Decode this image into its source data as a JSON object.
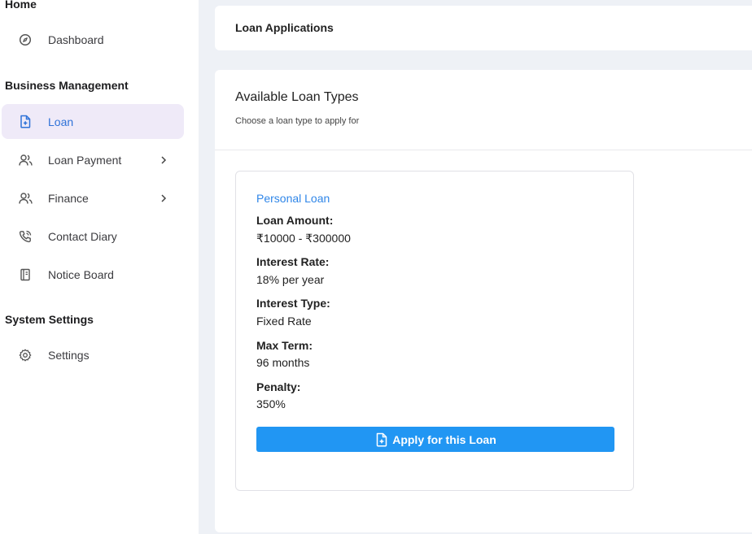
{
  "sidebar": {
    "sections": {
      "home": "Home",
      "business": "Business Management",
      "system": "System Settings"
    },
    "items": {
      "dashboard": "Dashboard",
      "loan": "Loan",
      "loan_payment": "Loan Payment",
      "finance": "Finance",
      "contact_diary": "Contact Diary",
      "notice_board": "Notice Board",
      "settings": "Settings"
    },
    "active_item": "loan"
  },
  "topbar": {
    "title": "Loan Applications"
  },
  "main": {
    "heading": "Available Loan Types",
    "subheading": "Choose a loan type to apply for",
    "loans": [
      {
        "name": "Personal Loan",
        "fields": [
          {
            "label": "Loan Amount:",
            "value": "₹10000 - ₹300000"
          },
          {
            "label": "Interest Rate:",
            "value": "18% per year"
          },
          {
            "label": "Interest Type:",
            "value": "Fixed Rate"
          },
          {
            "label": "Max Term:",
            "value": "96 months"
          },
          {
            "label": "Penalty:",
            "value": "350%"
          }
        ],
        "apply_label": "Apply for this Loan"
      }
    ]
  },
  "colors": {
    "accent": "#2196f3",
    "active_bg": "#efeaf8",
    "active_text": "#2f72d8",
    "loan_title": "#2f86e8",
    "page_bg": "#eef1f6"
  }
}
